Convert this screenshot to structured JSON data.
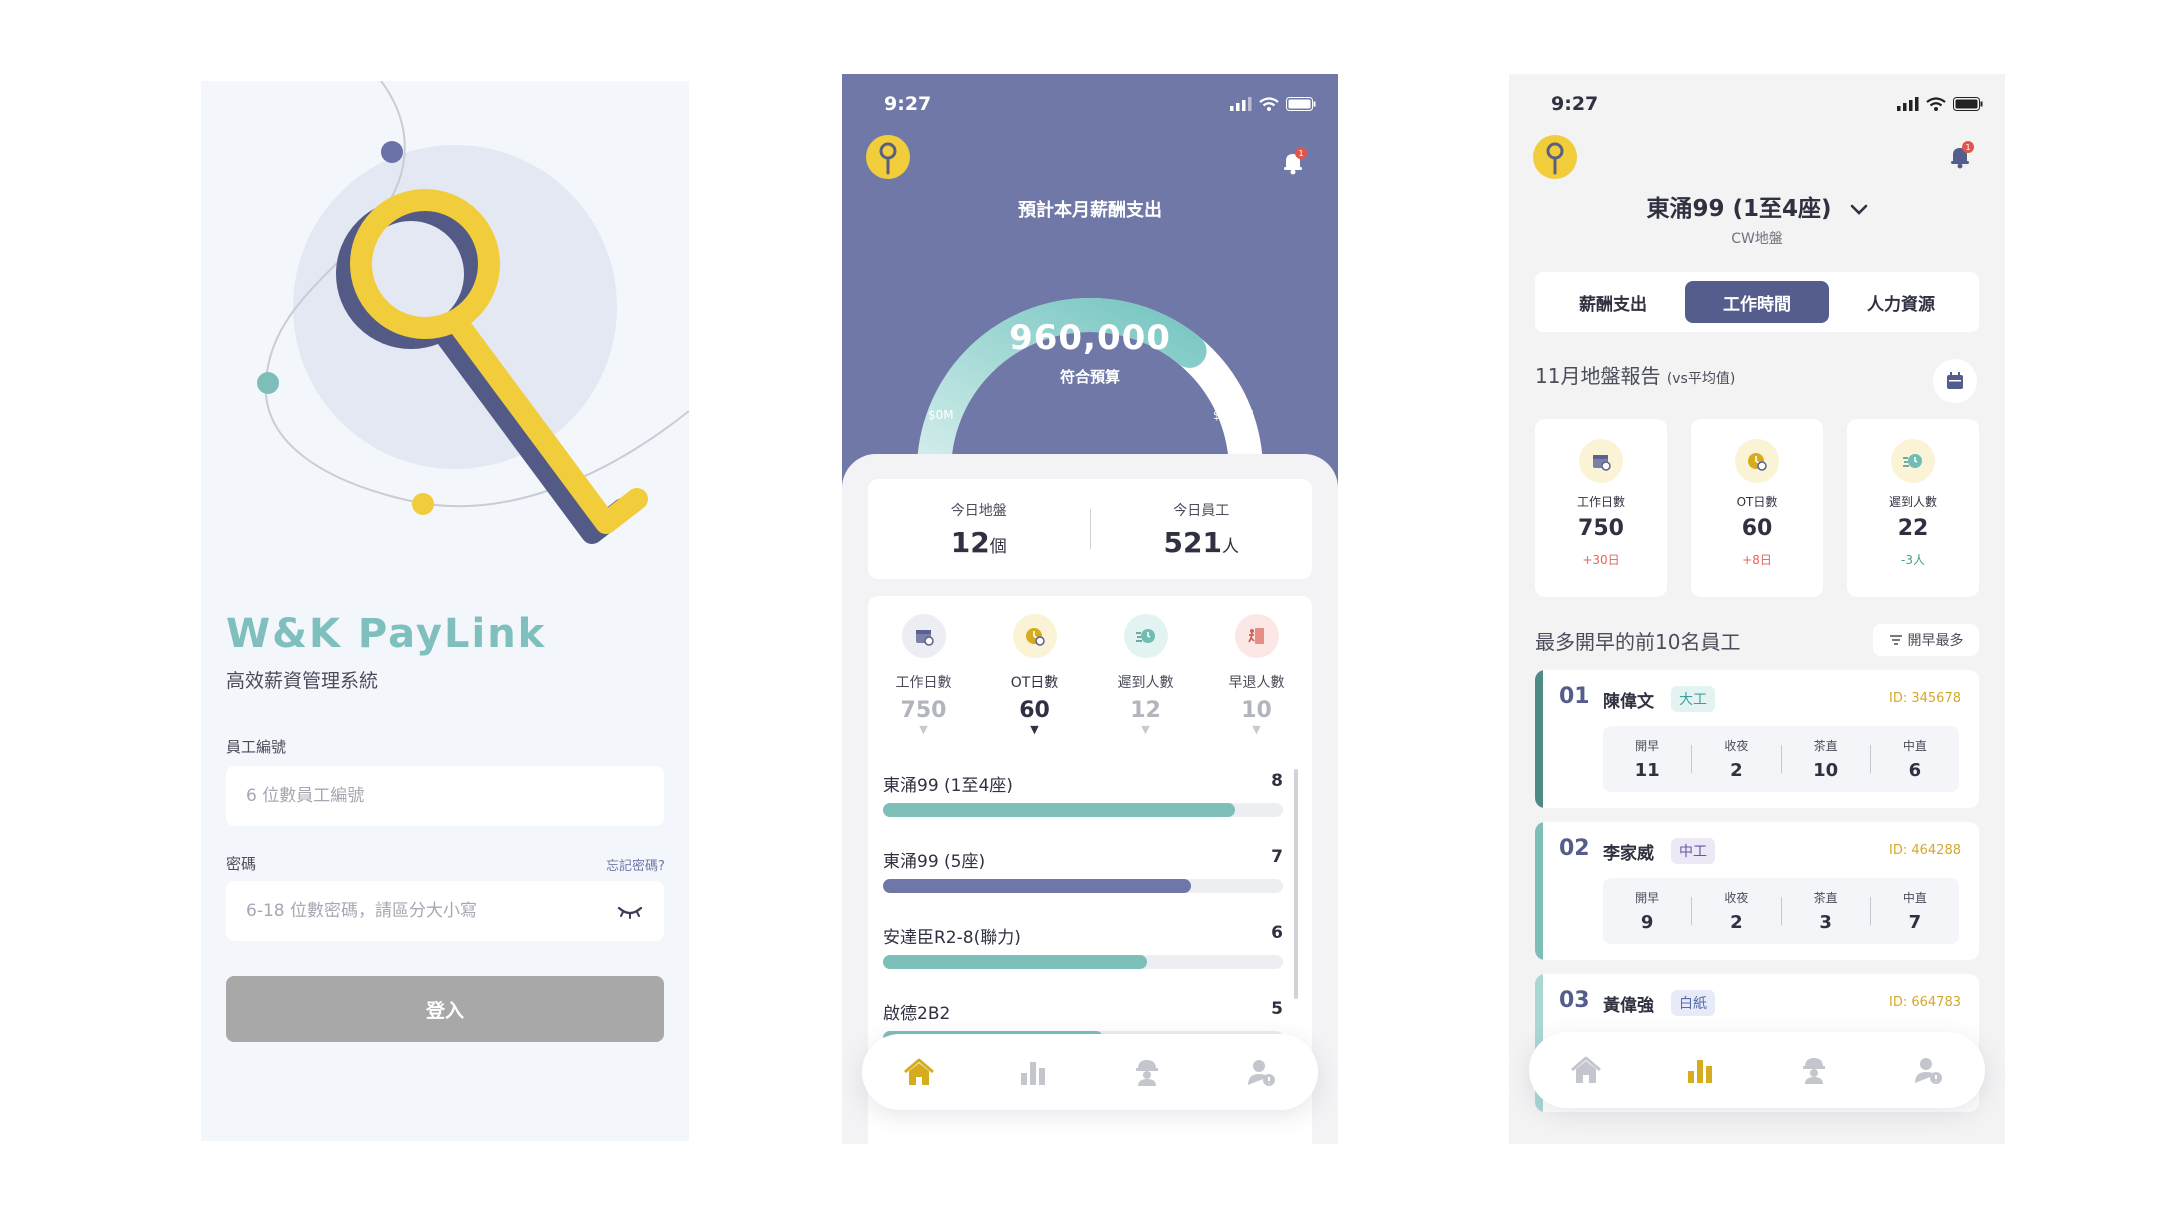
{
  "login": {
    "brand_title": "W&K PayLink",
    "brand_subtitle": "高效薪資管理系統",
    "employee_id_label": "員工編號",
    "employee_id_placeholder": "6 位數員工編號",
    "password_label": "密碼",
    "forgot_password": "忘記密碼?",
    "password_placeholder": "6-18 位數密碼，請區分大小寫",
    "submit_label": "登入",
    "colors": {
      "brand": "#7fbfbe",
      "key": "#f1cd3c",
      "key_shadow": "#535a86",
      "button": "#a8a8a8"
    }
  },
  "dashboard": {
    "time": "9:27",
    "notification_badge": "1",
    "gauge": {
      "title": "預計本月薪酬支出",
      "value": "960,000",
      "note": "符合預算",
      "min_label": "$0M",
      "max_label": "$150M",
      "fill_fraction": 0.72
    },
    "today": {
      "sites_label": "今日地盤",
      "sites_value": "12",
      "sites_unit": "個",
      "staff_label": "今日員工",
      "staff_value": "521",
      "staff_unit": "人"
    },
    "stats": [
      {
        "label": "工作日數",
        "value": "750",
        "icon": "calendar-icon",
        "active": false
      },
      {
        "label": "OT日數",
        "value": "60",
        "icon": "overtime-clock-icon",
        "active": true
      },
      {
        "label": "遲到人數",
        "value": "12",
        "icon": "running-late-icon",
        "active": false
      },
      {
        "label": "早退人數",
        "value": "10",
        "icon": "early-leave-icon",
        "active": false
      }
    ],
    "sites": [
      {
        "name": "東涌99 (1至4座)",
        "count": "8",
        "fraction": 1.0,
        "color": "#7dbfb8"
      },
      {
        "name": "東涌99 (5座)",
        "count": "7",
        "fraction": 0.875,
        "color": "#6f77a8"
      },
      {
        "name": "安達臣R2-8(聯力)",
        "count": "6",
        "fraction": 0.75,
        "color": "#7dbfb8"
      },
      {
        "name": "啟德2B2",
        "count": "5",
        "fraction": 0.625,
        "color": "#7dbfb8"
      }
    ],
    "nav": [
      "home-icon",
      "chart-icon",
      "worker-icon",
      "profile-icon"
    ],
    "colors": {
      "header": "#7078a8",
      "teal": "#7dbfb8",
      "indigo": "#6f77a8",
      "accent": "#d6ac1f"
    }
  },
  "site_report": {
    "time": "9:27",
    "notification_badge": "1",
    "site_name": "東涌99 (1至4座)",
    "site_subtitle": "CW地盤",
    "tabs": [
      {
        "label": "薪酬支出",
        "active": false
      },
      {
        "label": "工作時間",
        "active": true
      },
      {
        "label": "人力資源",
        "active": false
      }
    ],
    "report_title": "11月地盤報告",
    "report_title_note": "(vs平均值)",
    "metrics": [
      {
        "label": "工作日數",
        "value": "750",
        "delta": "+30日",
        "delta_color": "#e0665a",
        "icon": "calendar-icon"
      },
      {
        "label": "OT日數",
        "value": "60",
        "delta": "+8日",
        "delta_color": "#e0665a",
        "icon": "overtime-clock-icon"
      },
      {
        "label": "遲到人數",
        "value": "22",
        "delta": "-3人",
        "delta_color": "#4aa27b",
        "icon": "running-late-icon"
      }
    ],
    "top_title": "最多開早的前10名員工",
    "sort_label": "開早最多",
    "stat_labels": [
      "開早",
      "收夜",
      "茶直",
      "中直"
    ],
    "employees": [
      {
        "rank": "01",
        "name": "陳偉文",
        "grade": "大工",
        "grade_color": "#3f9f9b",
        "grade_bg": "#e3f3f2",
        "id": "ID: 345678",
        "stats": [
          "11",
          "2",
          "10",
          "6"
        ],
        "accent": "#4f8a86"
      },
      {
        "rank": "02",
        "name": "李家威",
        "grade": "中工",
        "grade_color": "#6a55a8",
        "grade_bg": "#ece8f6",
        "id": "ID: 464288",
        "stats": [
          "9",
          "2",
          "3",
          "7"
        ],
        "accent": "#7dbfb8"
      },
      {
        "rank": "03",
        "name": "黃偉強",
        "grade": "白紙",
        "grade_color": "#5a6ab0",
        "grade_bg": "#e7ebf7",
        "id": "ID: 664783",
        "stats": [],
        "accent": "#a9d8d3"
      }
    ],
    "nav": [
      "home-icon",
      "chart-icon",
      "worker-icon",
      "profile-icon"
    ]
  }
}
